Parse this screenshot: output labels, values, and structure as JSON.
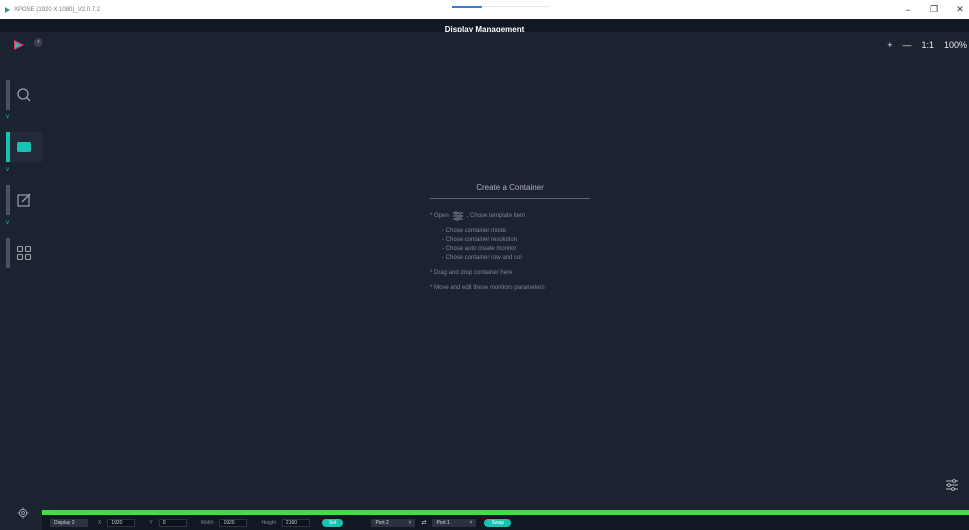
{
  "window": {
    "title": "XPOSE (1920 X 1080)_V2.0.7.2",
    "controls": {
      "minimize": "−",
      "restore": "❐",
      "close": "✕"
    }
  },
  "header": {
    "title": "Display Management"
  },
  "sidebar": {
    "expand_icon": "›",
    "items": [
      {
        "name": "search",
        "icon": "search-icon"
      },
      {
        "name": "display",
        "icon": "monitor-icon",
        "active": true
      },
      {
        "name": "edit",
        "icon": "edit-icon"
      },
      {
        "name": "layout",
        "icon": "grid-icon"
      }
    ],
    "caret": "v"
  },
  "zoom": {
    "plus": "+",
    "minus": "—",
    "ratio": "1:1",
    "level": "100%"
  },
  "hint": {
    "title": "Create a Container",
    "step_open_prefix": "* Open",
    "step_open_suffix": ", Chose template item",
    "substeps": [
      "- Chose container mode",
      "- Chose container resolution",
      "- Chose auto create monitor",
      "- Chose container row and col"
    ],
    "step_drag": "* Drag and drop container here",
    "step_move": "* Move and edit these monitors parameters"
  },
  "bottom": {
    "display_value": "Display 2",
    "x_label": "X",
    "x_value": "1920",
    "y_label": "Y",
    "y_value": "0",
    "width_label": "Width",
    "width_value": "1920",
    "height_label": "Height",
    "height_value": "2160",
    "set_label": "Set",
    "port_a": "Port 2",
    "port_b": "Port 1",
    "swap_symbol": "⇄",
    "swap_label": "Swap",
    "dropdown_arrow": "˅"
  },
  "colors": {
    "accent": "#17c3b2",
    "progress": "#3ee23e",
    "background": "#1b2230",
    "brand_pink": "#e63a6f"
  }
}
